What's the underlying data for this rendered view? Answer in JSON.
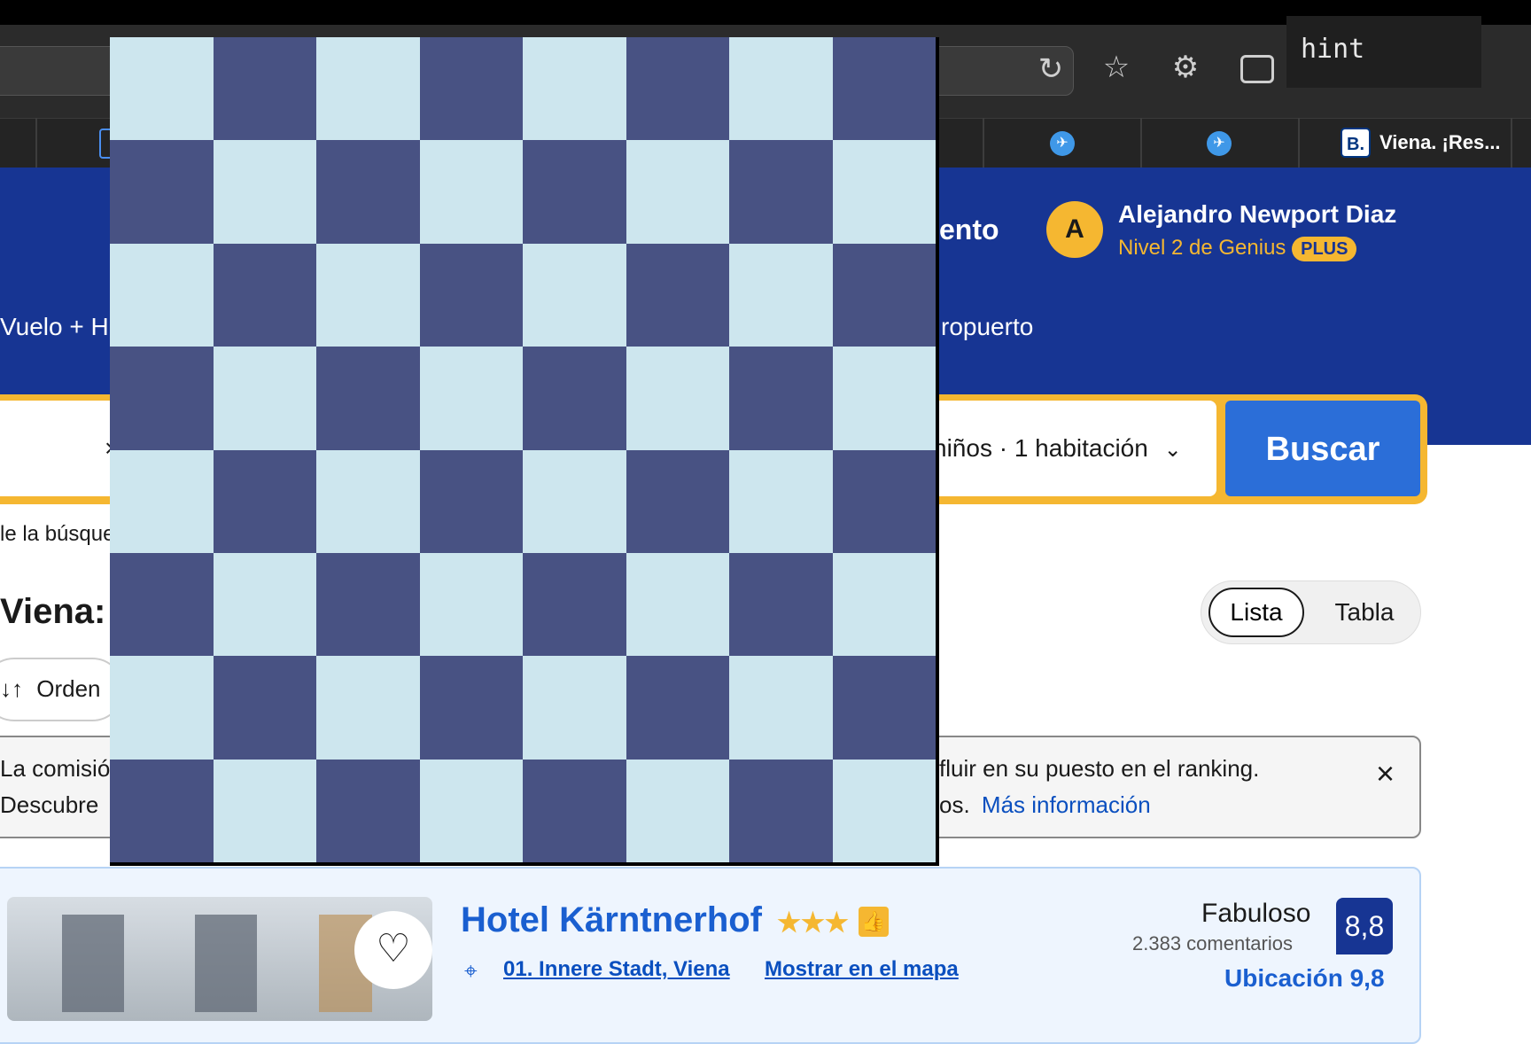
{
  "browser": {
    "hint": "hint",
    "tabs": [
      {
        "title": "Viena. ¡Res...",
        "icon": "B."
      }
    ],
    "icons": [
      "reload-icon",
      "star-icon",
      "gear-icon",
      "printer-icon"
    ]
  },
  "header": {
    "partial_title": "ento",
    "user_initial": "A",
    "user_name": "Alejandro Newport Diaz",
    "genius_level": "Nivel 2 de Genius",
    "plus_badge": "PLUS",
    "nav_left": "Vuelo + H",
    "nav_right": "ropuerto"
  },
  "search": {
    "guests_label": "niños · 1 habitación",
    "button_label": "Buscar",
    "partial_caption": "le la búsque"
  },
  "results": {
    "partial_title": "Viena: 2",
    "sort_label": "Orden",
    "view_options": [
      "Lista",
      "Tabla"
    ]
  },
  "notice": {
    "line1_left": "La comisió",
    "line1_right": "fluir en su puesto en el ranking.",
    "line2_left": "Descubre",
    "line2_right": "os.",
    "link": "Más información"
  },
  "hotel": {
    "name": "Hotel Kärntnerhof",
    "stars": "★★★",
    "location": "01. Innere Stadt, Viena",
    "map_link": "Mostrar en el mapa",
    "rating_word": "Fabuloso",
    "reviews": "2.383 comentarios",
    "score": "8,8",
    "location_score": "Ubicación 9,8"
  },
  "overlay": {
    "rows": 8,
    "cols": 8,
    "colors": {
      "light": "#cde6ee",
      "dark": "#485283"
    }
  }
}
